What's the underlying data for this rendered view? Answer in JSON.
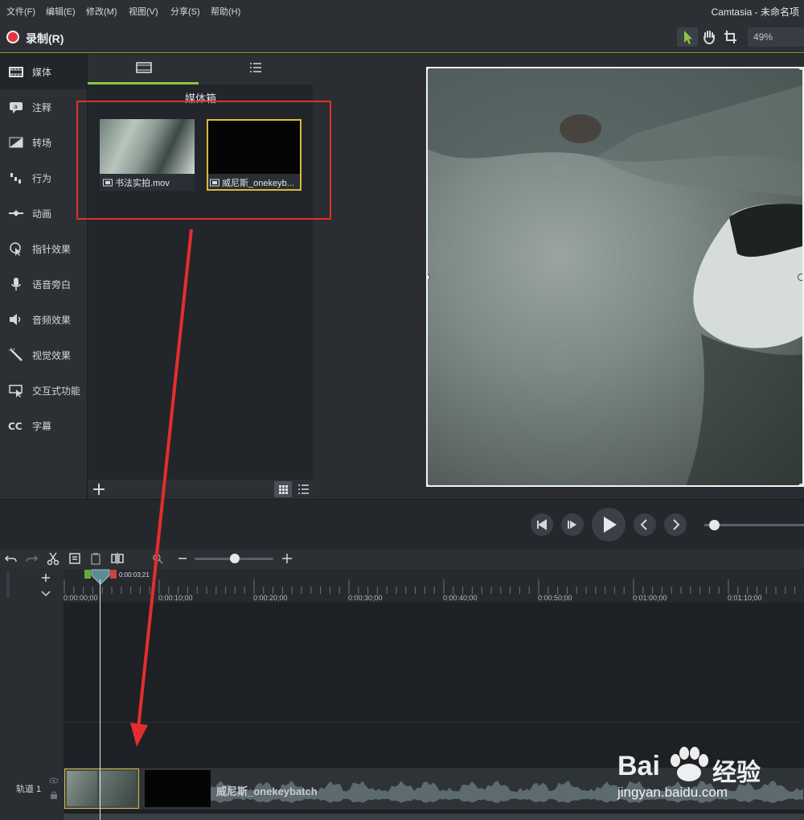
{
  "menu": {
    "items": [
      "文件(F)",
      "编辑(E)",
      "修改(M)",
      "视图(V)",
      "分享(S)",
      "帮助(H)"
    ],
    "app_title": "Camtasia - 未命名项"
  },
  "toolbar": {
    "record_label": "录制(R)",
    "zoom_value": "49%"
  },
  "rail": {
    "items": [
      {
        "label": "媒体",
        "icon": "film-icon"
      },
      {
        "label": "注释",
        "icon": "annotation-icon"
      },
      {
        "label": "转场",
        "icon": "transition-icon"
      },
      {
        "label": "行为",
        "icon": "behavior-icon"
      },
      {
        "label": "动画",
        "icon": "animation-icon"
      },
      {
        "label": "指针效果",
        "icon": "cursor-effect-icon"
      },
      {
        "label": "语音旁白",
        "icon": "microphone-icon"
      },
      {
        "label": "音频效果",
        "icon": "speaker-icon"
      },
      {
        "label": "视觉效果",
        "icon": "magic-wand-icon"
      },
      {
        "label": "交互式功能",
        "icon": "interactive-icon"
      },
      {
        "label": "字幕",
        "icon": "cc-icon"
      }
    ]
  },
  "bin": {
    "title": "媒体箱",
    "thumbnails": [
      {
        "caption": "书法实拍.mov"
      },
      {
        "caption": "威尼斯_onekeyb..."
      }
    ]
  },
  "ruler": {
    "playhead_time": "0:00:03;21",
    "ticks": [
      "0:00:00;00",
      "0:00:10;00",
      "0:00:20;00",
      "0:00:30;00",
      "0:00:40;00",
      "0:00:50;00",
      "0:01:00;00",
      "0:01:10;00"
    ]
  },
  "track": {
    "label": "轨道 1",
    "clip2_label": "威尼斯_onekeybatch"
  },
  "watermark": {
    "brand": "Bai",
    "brand2": "经验",
    "url": "jingyan.baidu.com"
  },
  "colors": {
    "accent": "#8cc63f",
    "record": "#e8333a",
    "annotation": "#e52d2d",
    "selection": "#e0b83a"
  }
}
